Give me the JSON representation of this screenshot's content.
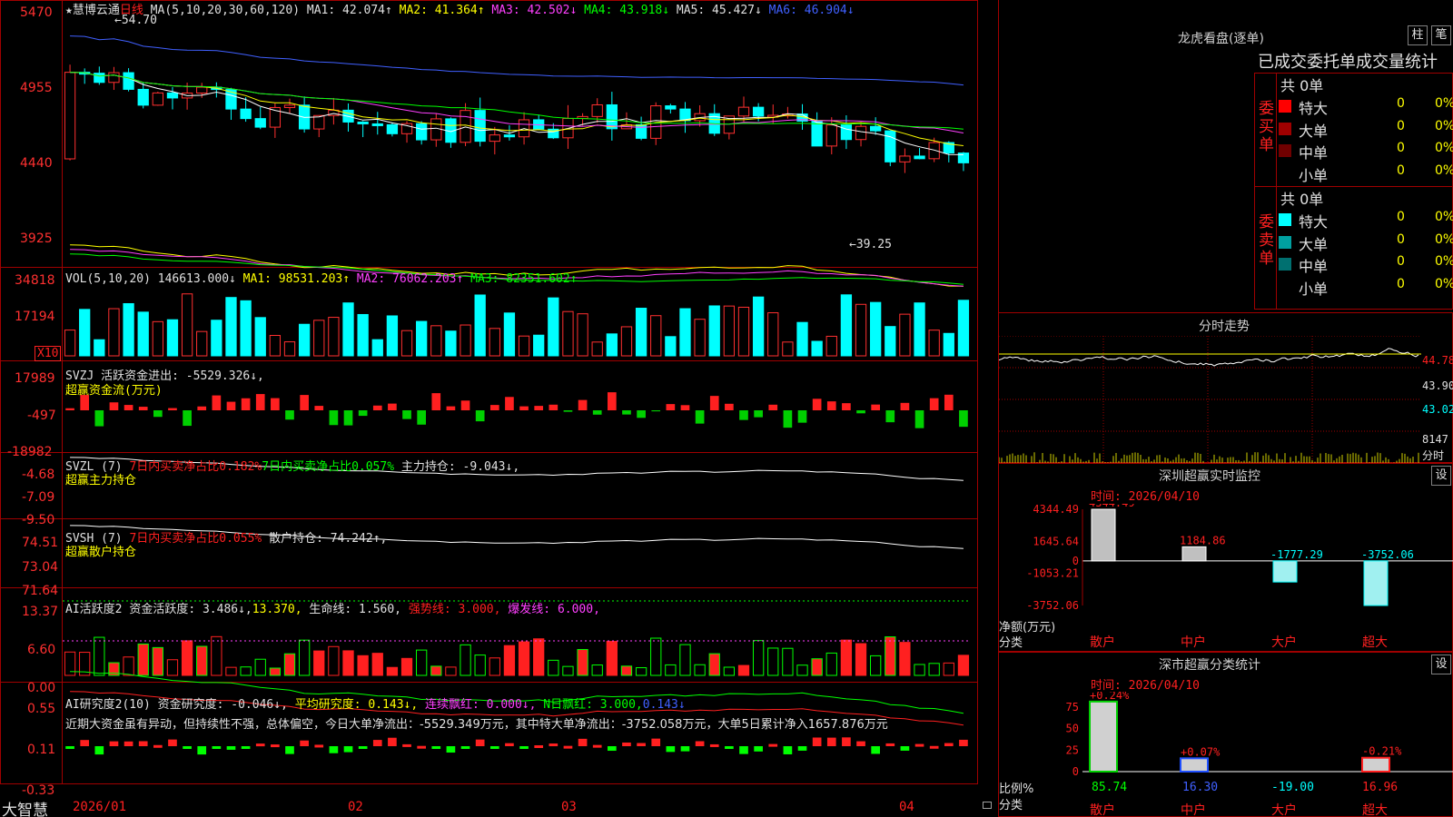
{
  "stock": {
    "name": "★慧博云通",
    "period": "日线",
    "ma_label": "MA(5,10,20,30,60,120)",
    "ma1": "MA1: 42.074↑",
    "ma2": "MA2: 41.364↑",
    "ma3": "MA3: 42.502↓",
    "ma4": "MA4: 43.918↓",
    "ma5": "MA5: 45.427↓",
    "ma6": "MA6: 46.904↓",
    "high_mark": "←54.70",
    "low_mark": "←39.25",
    "price_axis": [
      "5470",
      "4955",
      "4440",
      "3925"
    ]
  },
  "vol": {
    "label": "VOL(5,10,20)",
    "value": "146613.000↓",
    "ma1": "MA1: 98531.203↑",
    "ma2": "MA2: 76062.203↑",
    "ma3": "MA3: 82351.602↑",
    "axis": [
      "34818",
      "17194",
      "X10"
    ]
  },
  "svzj": {
    "line1": "SVZJ  活跃资金进出: -5529.326↓,",
    "line2": "超赢资金流(万元)",
    "axis": [
      "17989",
      "-497",
      "-18982"
    ]
  },
  "svzl": {
    "label": "SVZL (7)",
    "t1": "7日内买卖净占比0.182%",
    "t2": "7日内买卖净占比0.057%",
    "t3": "主力持仓: -9.043↓,",
    "line2": "超赢主力持仓",
    "axis": [
      "-4.68",
      "-7.09",
      "-9.50"
    ]
  },
  "svsh": {
    "label": "SVSH (7)",
    "t1": "7日内买卖净占比0.055%",
    "t2": "散户持仓: 74.242↑,",
    "line2": "超赢散户持仓",
    "axis": [
      "74.51",
      "73.04",
      "71.64"
    ]
  },
  "ai1": {
    "label": "AI活跃度2",
    "t1": "资金活跃度: 3.486↓,",
    "t2": "13.370,",
    "t3": "生命线: 1.560,",
    "t4": "强势线: 3.000,",
    "t5": "爆发线: 6.000,",
    "axis": [
      "13.37",
      "6.60",
      "0.00"
    ]
  },
  "ai2": {
    "label": "AI研究度2(10)",
    "t1": "资金研究度: -0.046↓,",
    "t2": "平均研究度: 0.143↓,",
    "t3": "连续飘红: 0.000↓,",
    "t4": "N日飘红: 3.000,",
    "t5": "0.143↓",
    "comment": "近期大资金虽有异动，但持续性不强，总体偏空，今日大单净流出：-5529.349万元，其中特大单净流出：-3752.058万元，大单5日累计净入1657.876万元",
    "axis": [
      "0.55",
      "0.11",
      "-0.33"
    ]
  },
  "bottom": {
    "app": "大智慧",
    "dates": [
      "2026/01",
      "02",
      "03",
      "04"
    ]
  },
  "right": {
    "dragon_title": "龙虎看盘(逐单)",
    "btn_bar": "柱",
    "btn_trade": "笔",
    "stats_title": "已成交委托单成交量统计",
    "buy_side": "委买单",
    "sell_side": "委卖单",
    "total_buy": "共 0单",
    "total_sell": "共 0单",
    "buy_rows": [
      {
        "label": "特大",
        "num": "0",
        "pct": "0%",
        "color": "#ff0000"
      },
      {
        "label": "大单",
        "num": "0",
        "pct": "0%",
        "color": "#a00000"
      },
      {
        "label": "中单",
        "num": "0",
        "pct": "0%",
        "color": "#700000"
      },
      {
        "label": "小单",
        "num": "0",
        "pct": "0%",
        "color": "#000000"
      }
    ],
    "sell_rows": [
      {
        "label": "特大",
        "num": "0",
        "pct": "0%",
        "color": "#00ffff"
      },
      {
        "label": "大单",
        "num": "0",
        "pct": "0%",
        "color": "#00a0a0"
      },
      {
        "label": "中单",
        "num": "0",
        "pct": "0%",
        "color": "#007070"
      },
      {
        "label": "小单",
        "num": "0",
        "pct": "0%",
        "color": "#000000"
      }
    ],
    "intraday_title": "分时走势",
    "intraday_axis": [
      "44.78",
      "43.90",
      "43.02",
      "8147",
      "分时"
    ],
    "sz_monitor_title": "深圳超赢实时监控",
    "sz_set": "设",
    "sz_time": "时间: 2026/04/10",
    "sz_axis": [
      "4344.49",
      "1645.64",
      "0",
      "-1053.21",
      "-3752.06"
    ],
    "sz_values": [
      "4344.49",
      "1184.86",
      "-1777.29",
      "-3752.06"
    ],
    "sz_ylabel": "净额(万元)",
    "sz_xlabel": "分类",
    "cats": [
      "散户",
      "中户",
      "大户",
      "超大"
    ],
    "cls_title": "深市超赢分类统计",
    "cls_set": "设",
    "cls_time": "时间: 2026/04/10",
    "cls_top": [
      "+0.24%",
      "+0.07%",
      "",
      "-0.21%"
    ],
    "cls_axis": [
      "75",
      "50",
      "25",
      "0"
    ],
    "cls_values": [
      "85.74",
      "16.30",
      "-19.00",
      "16.96"
    ],
    "cls_ylabel": "比例%",
    "cls_xlabel": "分类"
  },
  "chart_data": {
    "type": "bar",
    "title": "深圳超赢实时监控",
    "ylabel": "净额(万元)",
    "xlabel": "分类",
    "categories": [
      "散户",
      "中户",
      "大户",
      "超大"
    ],
    "values": [
      4344.49,
      1184.86,
      -1777.29,
      -3752.06
    ],
    "ylim": [
      -3752.06,
      4344.49
    ]
  }
}
